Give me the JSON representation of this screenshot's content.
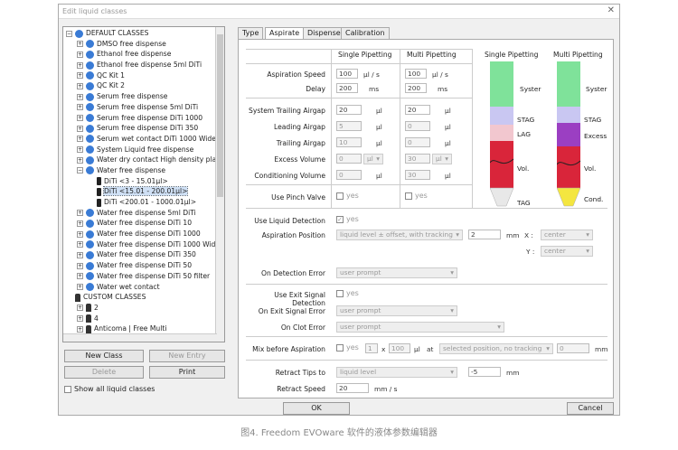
{
  "window": {
    "title": "Edit liquid classes",
    "close": "✕"
  },
  "tree": {
    "items": [
      {
        "text": "DEFAULT CLASSES",
        "exp": "−",
        "indent": 0,
        "icon": "blue"
      },
      {
        "text": "DMSO free dispense",
        "exp": "+",
        "indent": 1,
        "icon": "blue"
      },
      {
        "text": "Ethanol free dispense",
        "exp": "+",
        "indent": 1,
        "icon": "blue"
      },
      {
        "text": "Ethanol free dispense 5ml DiTi",
        "exp": "+",
        "indent": 1,
        "icon": "blue"
      },
      {
        "text": "QC Kit 1",
        "exp": "+",
        "indent": 1,
        "icon": "blue"
      },
      {
        "text": "QC Kit 2",
        "exp": "+",
        "indent": 1,
        "icon": "blue"
      },
      {
        "text": "Serum free dispense",
        "exp": "+",
        "indent": 1,
        "icon": "blue"
      },
      {
        "text": "Serum free dispense 5ml DiTi",
        "exp": "+",
        "indent": 1,
        "icon": "blue"
      },
      {
        "text": "Serum free dispense DiTi 1000",
        "exp": "+",
        "indent": 1,
        "icon": "blue"
      },
      {
        "text": "Serum free dispense DiTi 350",
        "exp": "+",
        "indent": 1,
        "icon": "blue"
      },
      {
        "text": "Serum wet contact DiTi 1000 Wide Bore",
        "exp": "+",
        "indent": 1,
        "icon": "blue"
      },
      {
        "text": "System Liquid free dispense",
        "exp": "+",
        "indent": 1,
        "icon": "blue"
      },
      {
        "text": "Water dry contact High density plate",
        "exp": "+",
        "indent": 1,
        "icon": "blue"
      },
      {
        "text": "Water free dispense",
        "exp": "−",
        "indent": 1,
        "icon": "blue"
      },
      {
        "text": "DiTi <3 - 15.01µl>",
        "exp": "",
        "indent": 2,
        "icon": "tip"
      },
      {
        "text": "DiTi <15.01 - 200.01µl>",
        "exp": "",
        "indent": 2,
        "icon": "tip",
        "selected": true
      },
      {
        "text": "DiTi <200.01 - 1000.01µl>",
        "exp": "",
        "indent": 2,
        "icon": "tip"
      },
      {
        "text": "Water free dispense 5ml DiTi",
        "exp": "+",
        "indent": 1,
        "icon": "blue"
      },
      {
        "text": "Water free dispense DiTi 10",
        "exp": "+",
        "indent": 1,
        "icon": "blue"
      },
      {
        "text": "Water free dispense DiTi 1000",
        "exp": "+",
        "indent": 1,
        "icon": "blue"
      },
      {
        "text": "Water free dispense DiTi 1000 Wide Bore",
        "exp": "+",
        "indent": 1,
        "icon": "blue"
      },
      {
        "text": "Water free dispense DiTi 350",
        "exp": "+",
        "indent": 1,
        "icon": "blue"
      },
      {
        "text": "Water free dispense DiTi 50",
        "exp": "+",
        "indent": 1,
        "icon": "blue"
      },
      {
        "text": "Water free dispense DiTi 50 filter",
        "exp": "+",
        "indent": 1,
        "icon": "blue"
      },
      {
        "text": "Water wet contact",
        "exp": "+",
        "indent": 1,
        "icon": "blue"
      },
      {
        "text": "CUSTOM CLASSES",
        "exp": "",
        "indent": 0,
        "icon": "person"
      },
      {
        "text": "2",
        "exp": "+",
        "indent": 1,
        "icon": "person"
      },
      {
        "text": "4",
        "exp": "+",
        "indent": 1,
        "icon": "person"
      },
      {
        "text": "Anticoma | Free Multi",
        "exp": "+",
        "indent": 1,
        "icon": "person"
      }
    ]
  },
  "buttons": {
    "new_class": "New Class",
    "new_entry": "New Entry",
    "delete": "Delete",
    "print": "Print",
    "ok": "OK",
    "cancel": "Cancel"
  },
  "show_all": "Show all liquid classes",
  "tabs": [
    "Type",
    "Aspirate",
    "Dispense",
    "Calibration"
  ],
  "cols": {
    "single": "Single Pipetting",
    "multi": "Multi Pipetting"
  },
  "params": {
    "asp_speed": {
      "label": "Aspiration Speed",
      "single": "100",
      "multi": "100",
      "unit": "µl / s"
    },
    "delay": {
      "label": "Delay",
      "single": "200",
      "multi": "200",
      "unit": "ms"
    },
    "stag": {
      "label": "System Trailing Airgap",
      "single": "20",
      "multi": "20",
      "unit": "µl"
    },
    "lag": {
      "label": "Leading Airgap",
      "single": "5",
      "multi": "0",
      "unit": "µl"
    },
    "tag": {
      "label": "Trailing Airgap",
      "single": "10",
      "multi": "0",
      "unit": "µl"
    },
    "excess": {
      "label": "Excess Volume",
      "single": "0",
      "multi": "30",
      "unit": "µl"
    },
    "cond": {
      "label": "Conditioning Volume",
      "single": "0",
      "multi": "30",
      "unit": "µl"
    },
    "pinch": {
      "label": "Use Pinch Valve",
      "single": "yes",
      "multi": "yes"
    }
  },
  "detection": {
    "use_label": "Use Liquid Detection",
    "use_val": "yes",
    "pos_label": "Aspiration Position",
    "pos_val": "liquid level ± offset, with tracking",
    "offset": "2",
    "offset_unit": "mm",
    "x_label": "X :",
    "x_val": "center",
    "y_label": "Y :",
    "y_val": "center",
    "err_label": "On Detection Error",
    "err_val": "user prompt"
  },
  "exit": {
    "use_label": "Use Exit Signal Detection",
    "use_val": "yes",
    "err_label": "On Exit Signal Error",
    "err_val": "user prompt",
    "clot_label": "On Clot Error",
    "clot_val": "user prompt"
  },
  "mix": {
    "label": "Mix before Aspiration",
    "yes": "yes",
    "count": "1",
    "x": "x",
    "vol": "100",
    "vol_unit": "µl",
    "at": "at",
    "pos": "selected position, no tracking",
    "offset": "0",
    "unit": "mm"
  },
  "retract": {
    "label": "Retract Tips to",
    "val": "liquid level",
    "offset": "-5",
    "unit": "mm",
    "speed_label": "Retract Speed",
    "speed": "20",
    "speed_unit": "mm / s"
  },
  "diagram": {
    "single_title": "Single Pipetting",
    "multi_title": "Multi Pipetting",
    "single_labels": [
      "Syster",
      "STAG",
      "LAG",
      "Vol.",
      "TAG"
    ],
    "multi_labels": [
      "Syster",
      "STAG",
      "Excess",
      "Vol.",
      "Cond."
    ]
  },
  "caption": "图4. Freedom EVOware 软件的液体参数编辑器"
}
